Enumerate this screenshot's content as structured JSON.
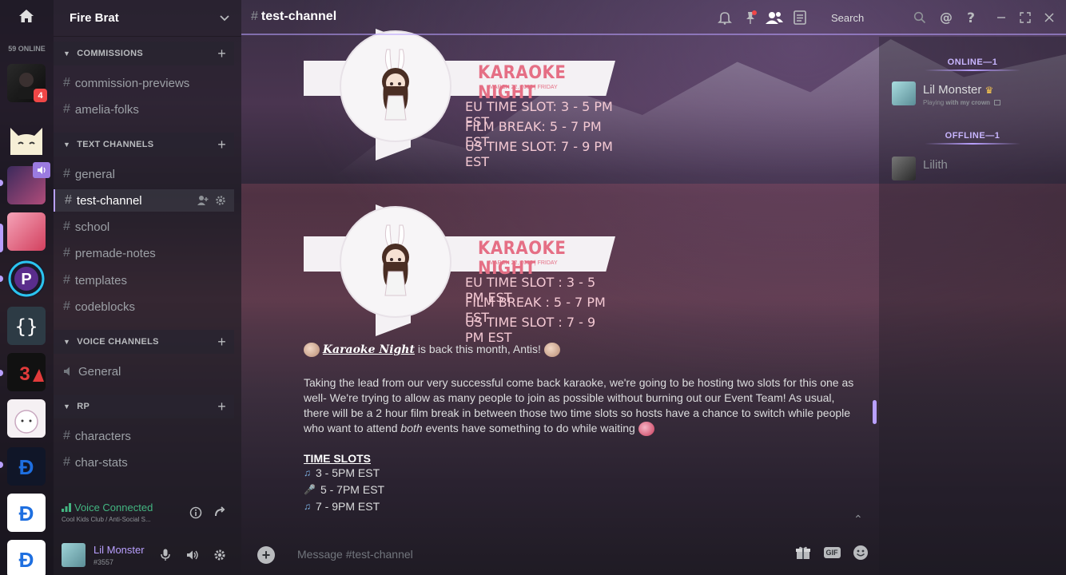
{
  "app": {
    "online_count": "59 ONLINE",
    "server_name": "Fire Brat",
    "unread_badge": "4",
    "accent": "#b9a0ff"
  },
  "categories": {
    "commissions": "COMMISSIONS",
    "text": "TEXT CHANNELS",
    "voice": "VOICE CHANNELS",
    "rp": "RP"
  },
  "channels": {
    "commissions": [
      "commission-previews",
      "amelia-folks"
    ],
    "text": [
      "general",
      "test-channel",
      "school",
      "premade-notes",
      "templates",
      "codeblocks"
    ],
    "voice": [
      "General"
    ],
    "rp": [
      "characters",
      "char-stats"
    ]
  },
  "voice_panel": {
    "status": "Voice Connected",
    "location": "Cool Kids Club / Anti-Social S..."
  },
  "user": {
    "name": "Lil Monster",
    "tag": "#3557"
  },
  "topbar": {
    "channel": "test-channel",
    "search_placeholder": "Search"
  },
  "message": {
    "banner": {
      "title": "KARAOKE NIGHT",
      "date": "MARCH 22, 2019 | FRIDAY",
      "lines_1": [
        "EU TIME SLOT: 3 - 5 PM EST",
        "FILM BREAK: 5 - 7 PM EST",
        "US TIME SLOT: 7 - 9 PM EST"
      ],
      "lines_2": [
        "EU TIME SLOT : 3 - 5 PM EST",
        "FILM BREAK : 5 - 7 PM EST",
        "US TIME SLOT : 7 - 9 PM EST"
      ]
    },
    "headline_title": "Karaoke Night",
    "headline_rest": "is back this month, Antis!",
    "paragraph_before": "Taking the lead from our very successful come back karaoke, we're going to be hosting two slots for this one as well- We're trying to allow as many people to join as possible without burning out our Event Team! As usual, there will be a 2 hour film break in between those two time slots so hosts have a chance to switch while people who want to attend",
    "paragraph_italic": "both",
    "paragraph_after": "events have something to do while waiting",
    "slots_title": "TIME SLOTS",
    "slots": [
      "3 - 5PM EST",
      "5 - 7PM EST",
      "7 - 9PM EST"
    ]
  },
  "composer": {
    "placeholder": "Message #test-channel",
    "gif_label": "GIF"
  },
  "members": {
    "online_header": "ONLINE—1",
    "offline_header": "OFFLINE—1",
    "online": [
      {
        "name": "Lil Monster",
        "status_prefix": "Playing",
        "status_game": "with my crown"
      }
    ],
    "offline": [
      {
        "name": "Lilith"
      }
    ]
  }
}
